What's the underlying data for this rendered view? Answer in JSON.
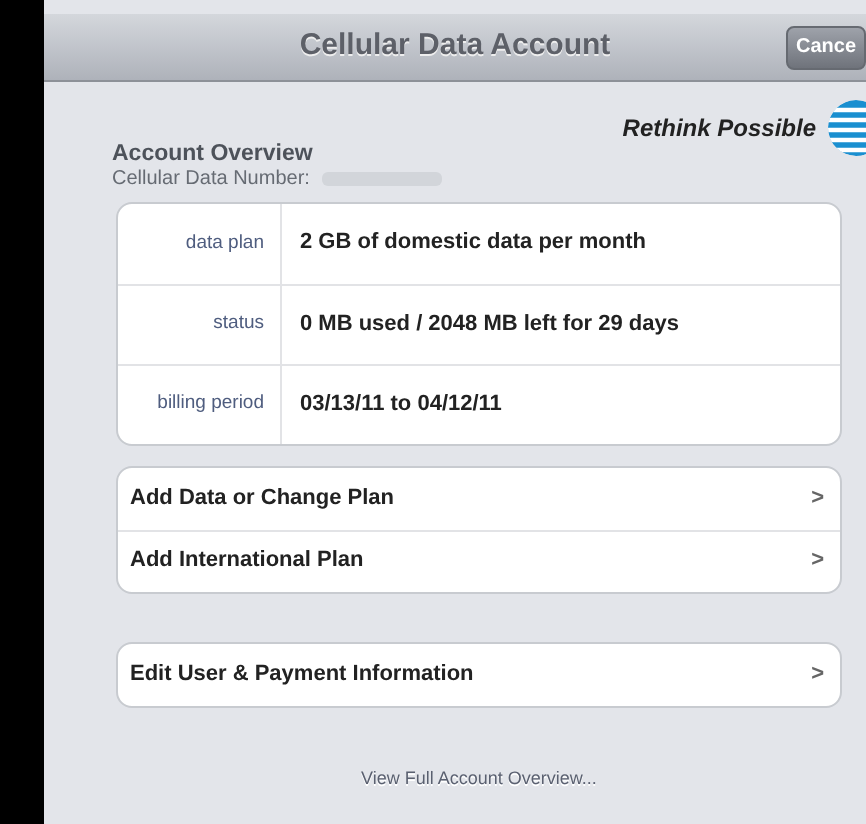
{
  "window": {
    "title": "Cellular Data Account",
    "button": "Cance"
  },
  "brand": {
    "tagline": "Rethink Possible"
  },
  "account": {
    "heading": "Account Overview",
    "number_label": "Cellular Data Number:"
  },
  "details": [
    {
      "label": "data plan",
      "value": "2 GB of domestic data per month"
    },
    {
      "label": "status",
      "value": "0 MB used / 2048 MB left for 29 days"
    },
    {
      "label": "billing period",
      "value": "03/13/11 to 04/12/11"
    }
  ],
  "menu_groups": [
    [
      "Add Data or Change Plan",
      "Add International Plan"
    ],
    [
      "Edit User & Payment Information"
    ]
  ],
  "chevron": ">",
  "link": "View Full Account Overview..."
}
